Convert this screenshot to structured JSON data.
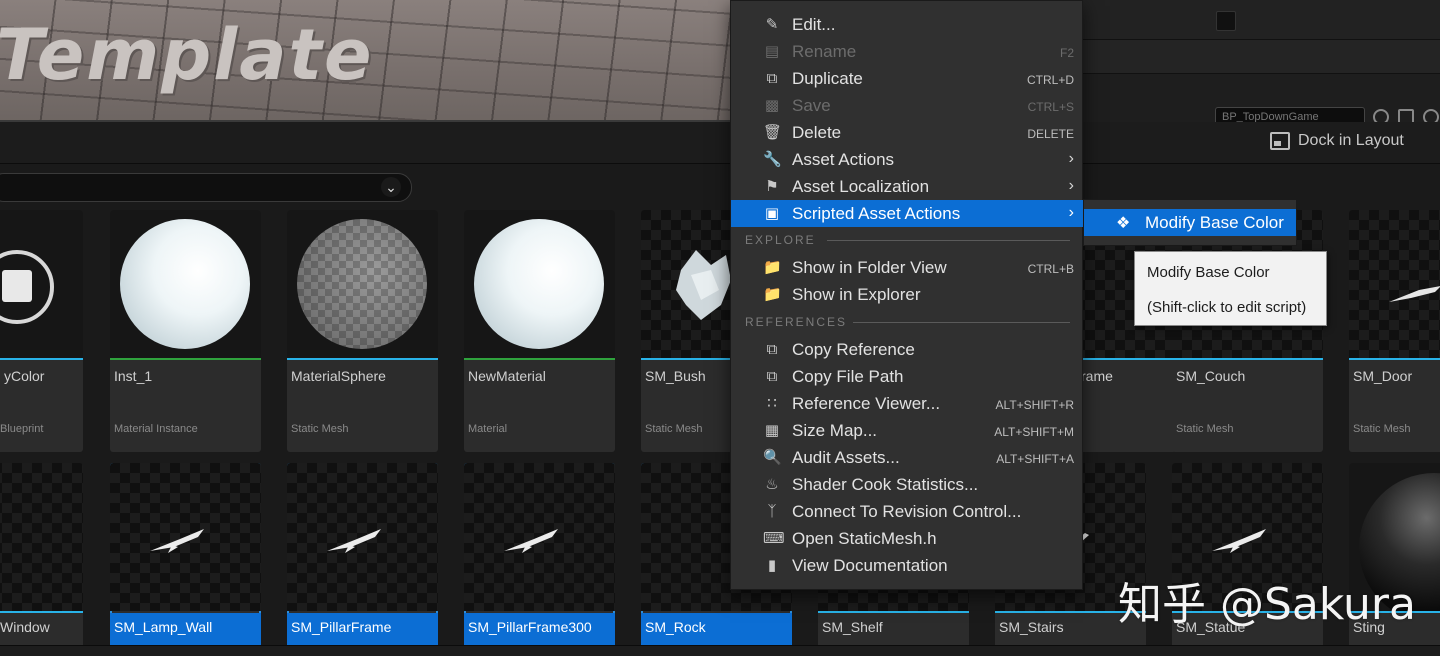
{
  "viewport": {
    "title": "Template"
  },
  "right_panel": {
    "blueprint_dropdown": "BP_TopDownGame"
  },
  "header": {
    "dock_label": "Dock in Layout"
  },
  "assets_row1": [
    {
      "name": "yColor",
      "type": "Blueprint",
      "stripe": "#29b3e8"
    },
    {
      "name": "Inst_1",
      "type": "Material Instance",
      "stripe": "#2fa33d"
    },
    {
      "name": "MaterialSphere",
      "type": "Static Mesh",
      "stripe": "#29b3e8"
    },
    {
      "name": "NewMaterial",
      "type": "Material",
      "stripe": "#2fa33d"
    },
    {
      "name": "SM_Bush",
      "type": "Static Mesh",
      "stripe": "#29b3e8"
    },
    {
      "name": "rame",
      "type": "",
      "stripe": "#29b3e8"
    },
    {
      "name": "SM_Couch",
      "type": "Static Mesh",
      "stripe": "#29b3e8"
    },
    {
      "name": "SM_Door",
      "type": "Static Mesh",
      "stripe": "#29b3e8"
    }
  ],
  "assets_row2": [
    {
      "name": "Window"
    },
    {
      "name": "SM_Lamp_Wall"
    },
    {
      "name": "SM_PillarFrame"
    },
    {
      "name": "SM_PillarFrame300"
    },
    {
      "name": "SM_Rock"
    },
    {
      "name": "SM_Shelf"
    },
    {
      "name": "SM_Stairs"
    },
    {
      "name": "SM_Statue"
    },
    {
      "name": "Sting"
    }
  ],
  "context_menu": {
    "items": [
      {
        "label": "Edit...",
        "shortcut": "",
        "icon": "pencil-icon"
      },
      {
        "label": "Rename",
        "shortcut": "F2",
        "icon": "rename-icon"
      },
      {
        "label": "Duplicate",
        "shortcut": "CTRL+D",
        "icon": "duplicate-icon"
      },
      {
        "label": "Save",
        "shortcut": "CTRL+S",
        "icon": "save-icon"
      },
      {
        "label": "Delete",
        "shortcut": "DELETE",
        "icon": "trash-icon"
      },
      {
        "label": "Asset Actions",
        "shortcut": "",
        "icon": "wrench-icon"
      },
      {
        "label": "Asset Localization",
        "shortcut": "",
        "icon": "flag-icon"
      },
      {
        "label": "Scripted Asset Actions",
        "shortcut": "",
        "icon": "script-icon"
      }
    ],
    "explore_header": "EXPLORE",
    "explore_items": [
      {
        "label": "Show in Folder View",
        "shortcut": "CTRL+B",
        "icon": "folder-search-icon"
      },
      {
        "label": "Show in Explorer",
        "shortcut": "",
        "icon": "folder-search-icon"
      }
    ],
    "references_header": "REFERENCES",
    "reference_items": [
      {
        "label": "Copy Reference",
        "shortcut": "",
        "icon": "copy-icon"
      },
      {
        "label": "Copy File Path",
        "shortcut": "",
        "icon": "copy-path-icon"
      },
      {
        "label": "Reference Viewer...",
        "shortcut": "ALT+SHIFT+R",
        "icon": "reference-viewer-icon"
      },
      {
        "label": "Size Map...",
        "shortcut": "ALT+SHIFT+M",
        "icon": "size-map-icon"
      },
      {
        "label": "Audit Assets...",
        "shortcut": "ALT+SHIFT+A",
        "icon": "audit-icon"
      },
      {
        "label": "Shader Cook Statistics...",
        "shortcut": "",
        "icon": "shader-icon"
      },
      {
        "label": "Connect To Revision Control...",
        "shortcut": "",
        "icon": "branch-icon"
      },
      {
        "label": "Open StaticMesh.h",
        "shortcut": "",
        "icon": "code-icon"
      },
      {
        "label": "View Documentation",
        "shortcut": "",
        "icon": "book-icon"
      }
    ]
  },
  "submenu": {
    "item": "Modify Base Color"
  },
  "tooltip": {
    "line1": "Modify Base Color",
    "line2": "(Shift-click to edit script)"
  },
  "watermark": "知乎 @Sakura",
  "colors": {
    "accent": "#0c6ed4",
    "menu_bg": "#303030",
    "mesh_stripe": "#29b3e8",
    "material_stripe": "#2fa33d"
  }
}
